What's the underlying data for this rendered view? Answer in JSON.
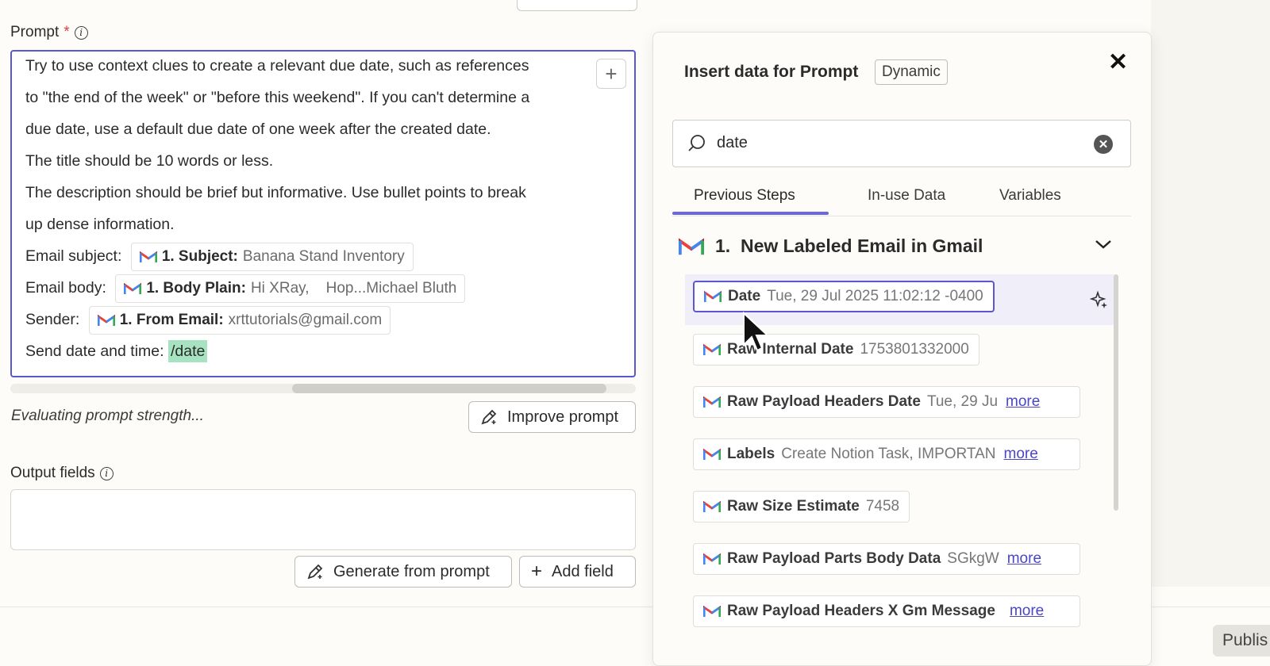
{
  "form": {
    "top_button_label": "Add field",
    "prompt_label": "Prompt",
    "required_mark": "*",
    "prompt_lines": [
      "Try to use context clues to create a relevant due date, such as references",
      "to \"the end of the week\" or \"before this weekend\". If you can't determine a",
      "due date, use a default due date of one week after the created date.",
      "The title should be 10 words or less.",
      "The description should be brief but informative. Use bullet points to break",
      "up dense information."
    ],
    "fields": [
      {
        "label": "Email subject:",
        "pill_key": "1. Subject:",
        "pill_value": "Banana Stand Inventory"
      },
      {
        "label": "Email body:",
        "pill_key": "1. Body Plain:",
        "pill_value": "Hi XRay,    Hop...Michael Bluth"
      },
      {
        "label": "Sender:",
        "pill_key": "1. From Email:",
        "pill_value": "xrttutorials@gmail.com"
      }
    ],
    "send_label": "Send date and time:",
    "send_token": "/date",
    "eval_text": "Evaluating prompt strength...",
    "improve_label": "Improve prompt",
    "output_label": "Output fields",
    "generate_label": "Generate from prompt",
    "add_field_label": "Add field",
    "publish_label": "Publis"
  },
  "panel": {
    "title": "Insert data for Prompt",
    "badge": "Dynamic",
    "search_value": "date",
    "tabs": [
      "Previous Steps",
      "In-use Data",
      "Variables"
    ],
    "active_tab": "Previous Steps",
    "section_title": "1.  New Labeled Email in Gmail",
    "items": [
      {
        "key": "Date",
        "value": "Tue, 29 Jul 2025 11:02:12 -0400",
        "more": ""
      },
      {
        "key": "Raw Internal Date",
        "value": "1753801332000",
        "more": ""
      },
      {
        "key": "Raw Payload Headers Date",
        "value": "Tue, 29 Ju",
        "more": "more"
      },
      {
        "key": "Labels",
        "value": "Create Notion Task, IMPORTAN",
        "more": "more"
      },
      {
        "key": "Raw Size Estimate",
        "value": "7458",
        "more": ""
      },
      {
        "key": "Raw Payload Parts Body Data",
        "value": "SGkgW",
        "more": "more"
      },
      {
        "key": "Raw Payload Headers X Gm Message",
        "value": "",
        "more": "more"
      }
    ]
  },
  "colors": {
    "accent": "#5b57d1",
    "highlight": "#a7e3c0",
    "gmail_red": "#ea4335"
  }
}
